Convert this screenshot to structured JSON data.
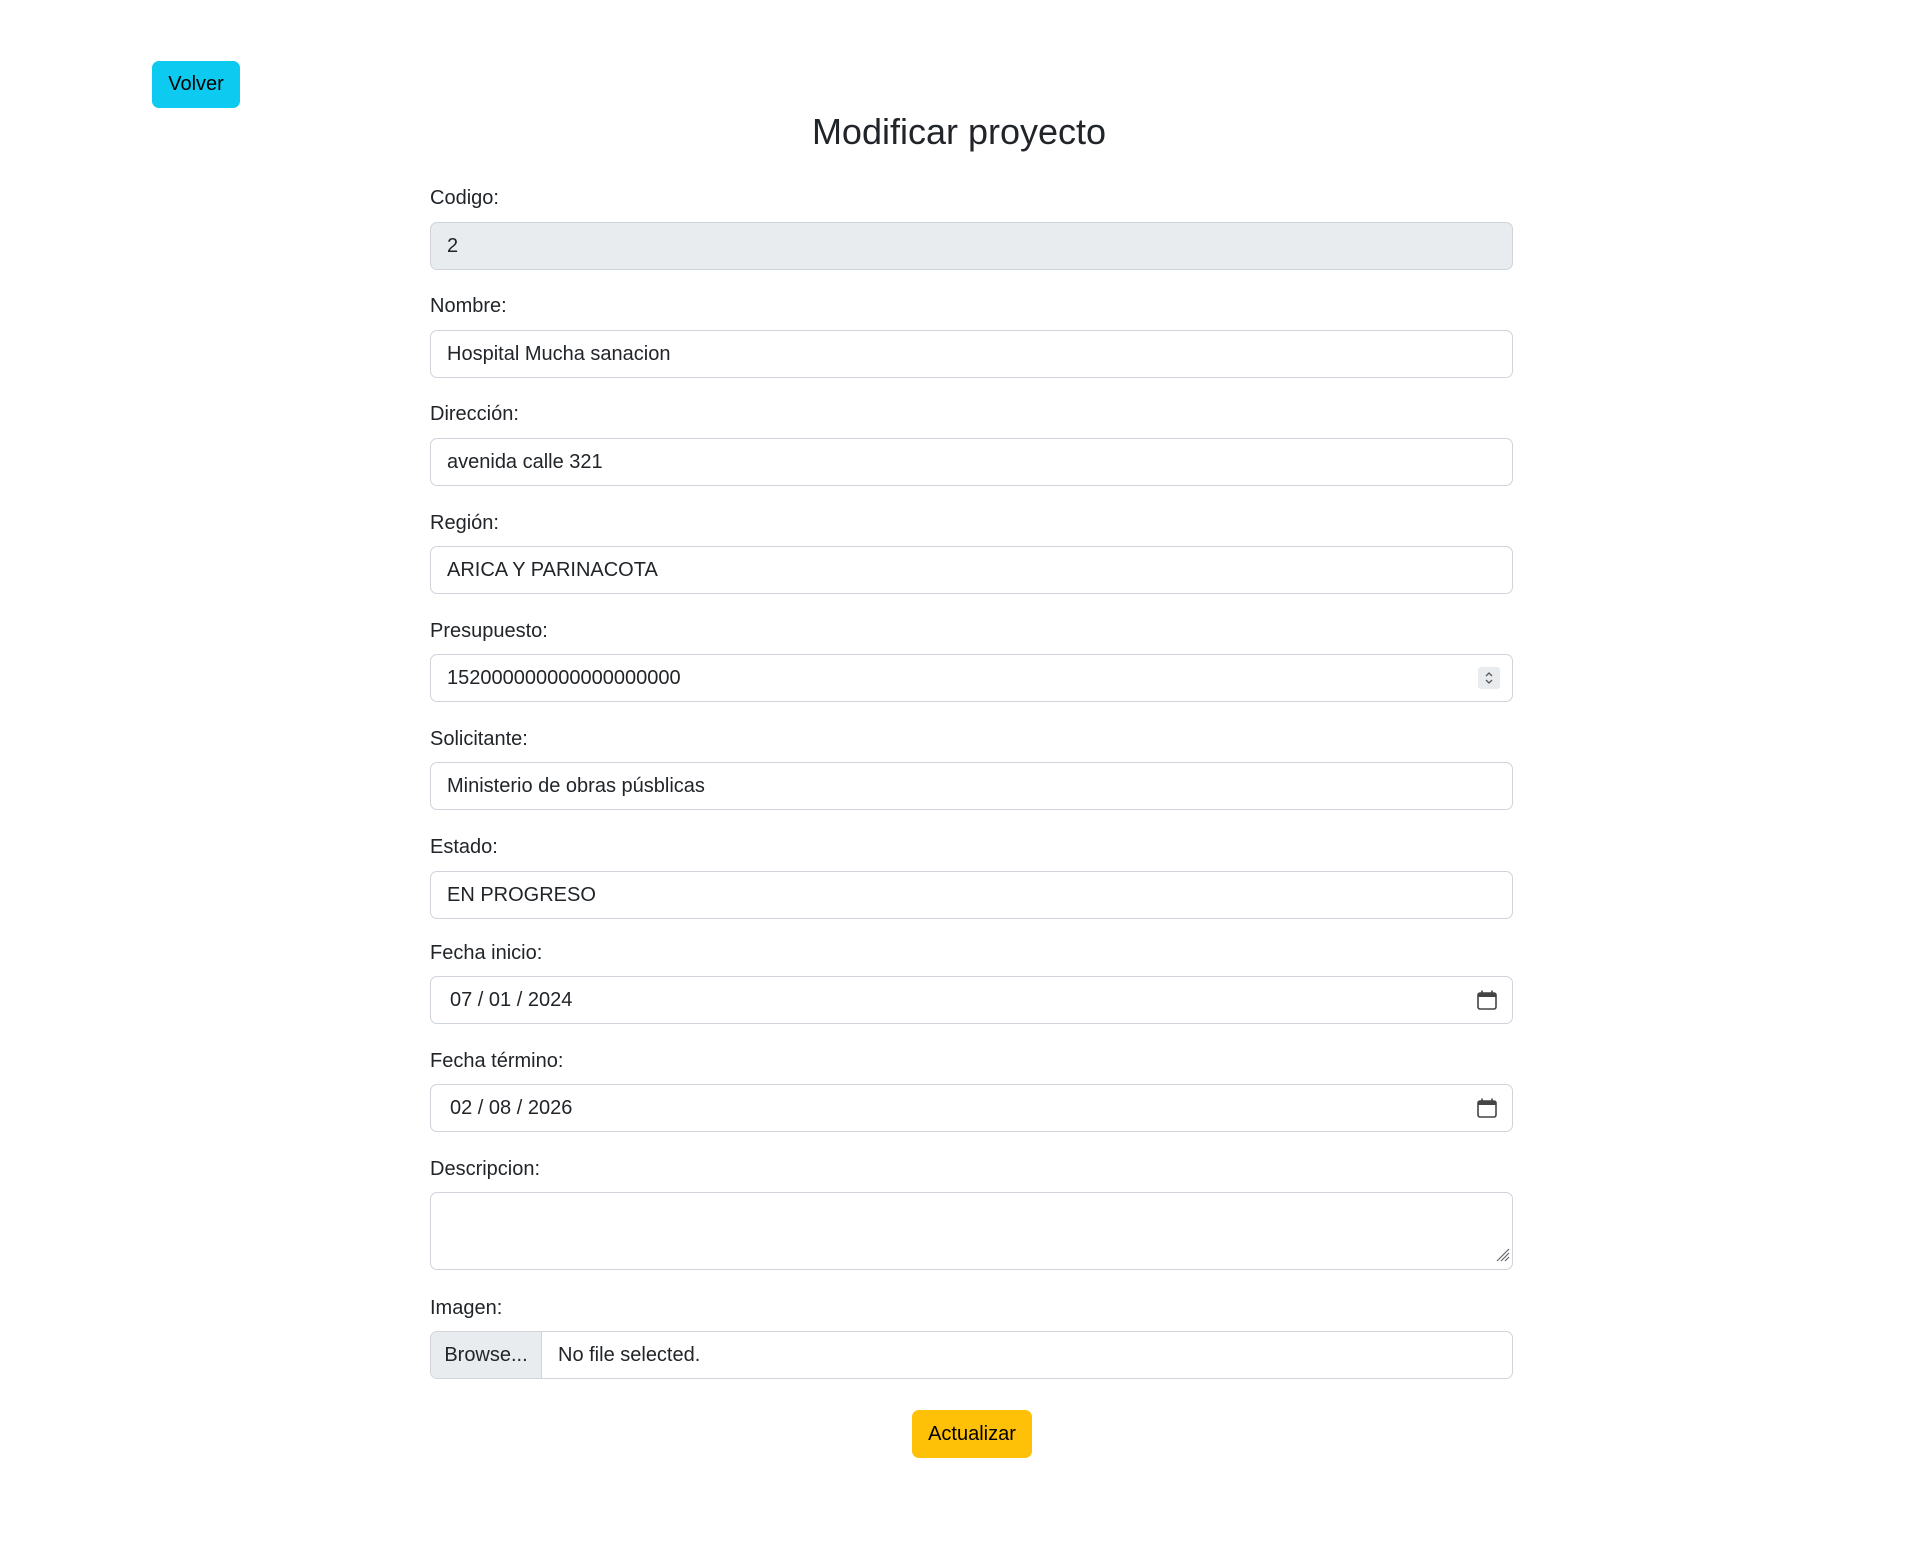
{
  "nav": {
    "back_label": "Volver"
  },
  "page": {
    "title": "Modificar proyecto"
  },
  "form": {
    "codigo": {
      "label": "Codigo:",
      "value": "2"
    },
    "nombre": {
      "label": "Nombre:",
      "value": "Hospital Mucha sanacion"
    },
    "direccion": {
      "label": "Dirección:",
      "value": "avenida calle 321"
    },
    "region": {
      "label": "Región:",
      "value": "ARICA Y PARINACOTA"
    },
    "presupuesto": {
      "label": "Presupuesto:",
      "value": "152000000000000000000"
    },
    "solicitante": {
      "label": "Solicitante:",
      "value": "Ministerio de obras púsblicas"
    },
    "estado": {
      "label": "Estado:",
      "value": "EN PROGRESO"
    },
    "fecha_inicio": {
      "label": "Fecha inicio:",
      "value": "07 / 01 / 2024"
    },
    "fecha_termino": {
      "label": "Fecha término:",
      "value": "02 / 08 / 2026"
    },
    "descripcion": {
      "label": "Descripcion:",
      "value": ""
    },
    "imagen": {
      "label": "Imagen:",
      "browse_label": "Browse...",
      "status": "No file selected."
    },
    "submit_label": "Actualizar"
  },
  "colors": {
    "info": "#0dcaf0",
    "warning": "#ffc107",
    "disabled_bg": "#e9ecef",
    "border": "#ced4da"
  },
  "icons": {
    "date": "calendar-icon",
    "number": "spinner-icon",
    "resize": "resize-handle-icon"
  }
}
